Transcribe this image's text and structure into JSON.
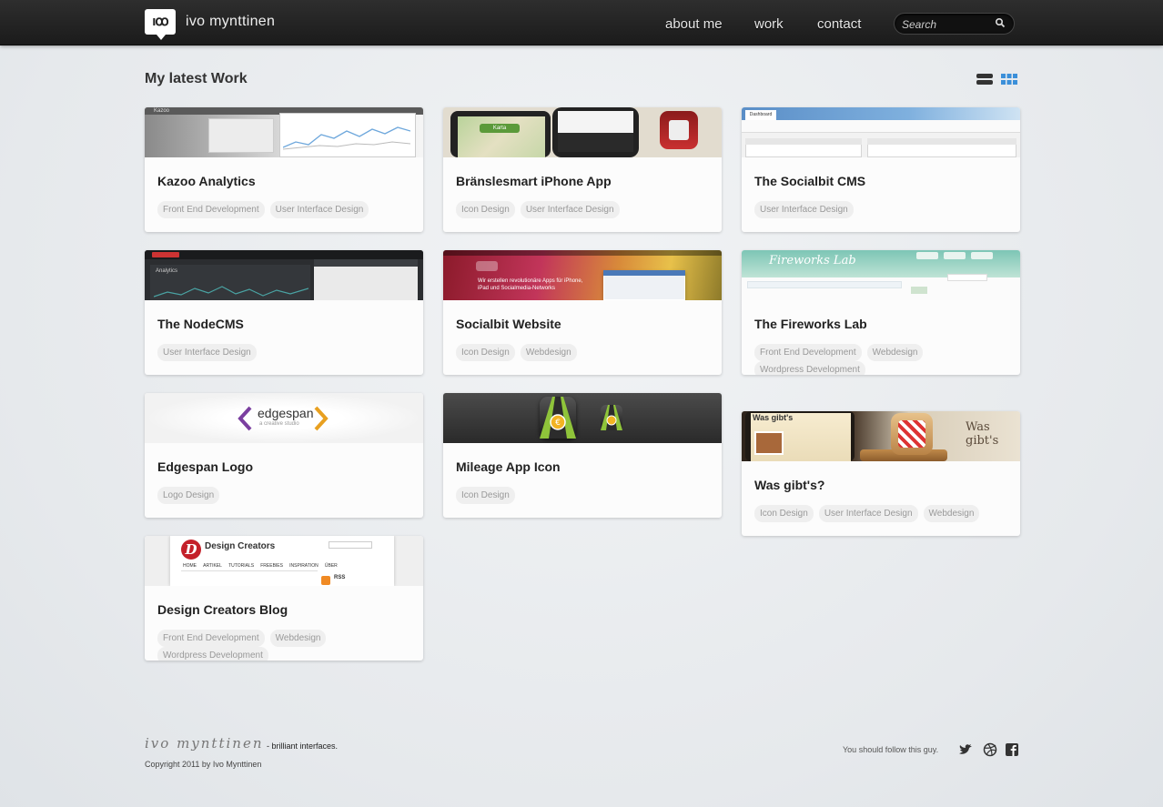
{
  "header": {
    "logo_text": "ıꝏ",
    "site_name": "ivo mynttinen",
    "nav": [
      "about me",
      "work",
      "contact"
    ],
    "search_placeholder": "Search"
  },
  "main": {
    "heading": "My latest Work",
    "view_toggle": [
      "list-view",
      "grid-view"
    ]
  },
  "projects": [
    {
      "title": "Kazoo Analytics",
      "tags": [
        "Front End Development",
        "User Interface Design"
      ]
    },
    {
      "title": "Bränslesmart iPhone App",
      "tags": [
        "Icon Design",
        "User Interface Design"
      ]
    },
    {
      "title": "The Socialbit CMS",
      "tags": [
        "User Interface Design"
      ]
    },
    {
      "title": "The NodeCMS",
      "tags": [
        "User Interface Design"
      ]
    },
    {
      "title": "Socialbit Website",
      "tags": [
        "Icon Design",
        "Webdesign"
      ]
    },
    {
      "title": "The Fireworks Lab",
      "tags": [
        "Front End Development",
        "Webdesign",
        "Wordpress Development"
      ]
    },
    {
      "title": "Edgespan Logo",
      "tags": [
        "Logo Design"
      ]
    },
    {
      "title": "Mileage App Icon",
      "tags": [
        "Icon Design"
      ]
    },
    {
      "title": "Was gibt's?",
      "tags": [
        "Icon Design",
        "User Interface Design",
        "Webdesign"
      ]
    },
    {
      "title": "Design Creators Blog",
      "tags": [
        "Front End Development",
        "Webdesign",
        "Wordpress Development"
      ]
    }
  ],
  "thumbs": {
    "edgespan": {
      "name": "edgespan",
      "sub": "a creative studio"
    },
    "design_creators": {
      "name": "Design Creators",
      "nav": [
        "HOME",
        "ARTIKEL",
        "TUTORIALS",
        "FREEBIES",
        "INSPIRATION",
        "ÜBER"
      ],
      "rss": "RSS"
    },
    "socialbit": {
      "text": "Wir erstellen revolutionäre Apps für iPhone, iPad und Socialmedia-Networks"
    },
    "fireworks": {
      "text": "Fireworks Lab"
    },
    "wasgibts": {
      "text": "Was gibt's"
    },
    "kazoo": {
      "text": "Kazoo"
    },
    "nodecms": {
      "text": "Analytics"
    },
    "socialbit_cms": {
      "text": "Dashboard"
    },
    "bransle": {
      "text": "Karta"
    }
  },
  "footer": {
    "signature": "ivo mynttinen",
    "tagline": "- brilliant interfaces.",
    "copyright": "Copyright 2011 by Ivo Mynttinen",
    "follow_text": "You should follow this guy.",
    "social": [
      "twitter-icon",
      "dribbble-icon",
      "facebook-icon"
    ]
  },
  "colors": {
    "accent": "#3b8fd9",
    "header_bg": "#1f1f1f",
    "page_bg": "#e8ebee"
  }
}
